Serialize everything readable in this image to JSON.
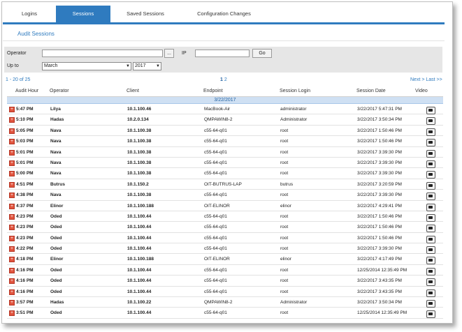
{
  "tabs": [
    {
      "label": "Logins"
    },
    {
      "label": "Sessions"
    },
    {
      "label": "Saved Sessions"
    },
    {
      "label": "Configuration Changes"
    }
  ],
  "page_title": "Audit Sessions",
  "filter": {
    "operator_label": "Operator",
    "operator_value": "",
    "browse_label": "...",
    "ip_label": "IP",
    "ip_value": "",
    "go_label": "Go",
    "upto_label": "Up to",
    "month_value": "March",
    "year_value": "2017"
  },
  "pager": {
    "range": "1 - 20 of 25",
    "current_page": "1",
    "next_page": "2",
    "next_last": "Next > Last >>"
  },
  "columns": [
    "Audit Hour",
    "Operator",
    "Client",
    "Endpoint",
    "Session Login",
    "Session Date",
    "Video"
  ],
  "date_group": "3/22/2017",
  "rows": [
    [
      "5:47 PM",
      "Lilya",
      "10.1.100.46",
      "MacBook-Air",
      "administrator",
      "3/22/2017 5:47:31 PM"
    ],
    [
      "5:10 PM",
      "Hadas",
      "10.2.0.134",
      "QMPAWIN8-2",
      "Administrator",
      "3/22/2017 3:50:34 PM"
    ],
    [
      "5:05 PM",
      "Nava",
      "10.1.100.38",
      "c55-64-q01",
      "root",
      "3/22/2017 1:50:46 PM"
    ],
    [
      "5:03 PM",
      "Nava",
      "10.1.100.38",
      "c55-64-q01",
      "root",
      "3/22/2017 1:50:46 PM"
    ],
    [
      "5:01 PM",
      "Nava",
      "10.1.100.38",
      "c55-64-q01",
      "root",
      "3/22/2017 3:39:30 PM"
    ],
    [
      "5:01 PM",
      "Nava",
      "10.1.100.38",
      "c55-64-q01",
      "root",
      "3/22/2017 3:39:30 PM"
    ],
    [
      "5:00 PM",
      "Nava",
      "10.1.100.38",
      "c55-64-q01",
      "root",
      "3/22/2017 3:39:30 PM"
    ],
    [
      "4:51 PM",
      "Butrus",
      "10.1.150.2",
      "OIT-BUTRUS-LAP",
      "butrus",
      "3/22/2017 3:20:59 PM"
    ],
    [
      "4:38 PM",
      "Nava",
      "10.1.100.38",
      "c55-64-q01",
      "root",
      "3/22/2017 3:39:30 PM"
    ],
    [
      "4:37 PM",
      "Elinor",
      "10.1.100.188",
      "OIT-ELINOR",
      "elinor",
      "3/22/2017 4:29:41 PM"
    ],
    [
      "4:23 PM",
      "Oded",
      "10.1.100.44",
      "c55-64-q01",
      "root",
      "3/22/2017 1:50:46 PM"
    ],
    [
      "4:23 PM",
      "Oded",
      "10.1.100.44",
      "c55-64-q01",
      "root",
      "3/22/2017 1:50:46 PM"
    ],
    [
      "4:23 PM",
      "Oded",
      "10.1.100.44",
      "c55-64-q01",
      "root",
      "3/22/2017 1:50:46 PM"
    ],
    [
      "4:22 PM",
      "Oded",
      "10.1.100.44",
      "c55-64-q01",
      "root",
      "3/22/2017 3:39:30 PM"
    ],
    [
      "4:18 PM",
      "Elinor",
      "10.1.100.188",
      "OIT-ELINOR",
      "elinor",
      "3/22/2017 4:17:49 PM"
    ],
    [
      "4:16 PM",
      "Oded",
      "10.1.100.44",
      "c55-64-q01",
      "root",
      "12/25/2014 12:35:49 PM"
    ],
    [
      "4:16 PM",
      "Oded",
      "10.1.100.44",
      "c55-64-q01",
      "root",
      "3/22/2017 3:43:35 PM"
    ],
    [
      "4:16 PM",
      "Oded",
      "10.1.100.44",
      "c55-64-q01",
      "root",
      "3/22/2017 3:43:35 PM"
    ],
    [
      "3:57 PM",
      "Hadas",
      "10.1.100.22",
      "QMPAWIN8-2",
      "Administrator",
      "3/22/2017 3:50:34 PM"
    ],
    [
      "3:51 PM",
      "Oded",
      "10.1.100.44",
      "c55-64-q01",
      "root",
      "12/25/2014 12:35:49 PM"
    ]
  ],
  "icons": {
    "expand": "expand-plus-icon",
    "video": "video-play-icon"
  },
  "colors": {
    "accent": "#2f7bbf",
    "expand": "#e0533d",
    "date_band": "#cfe0f3"
  }
}
